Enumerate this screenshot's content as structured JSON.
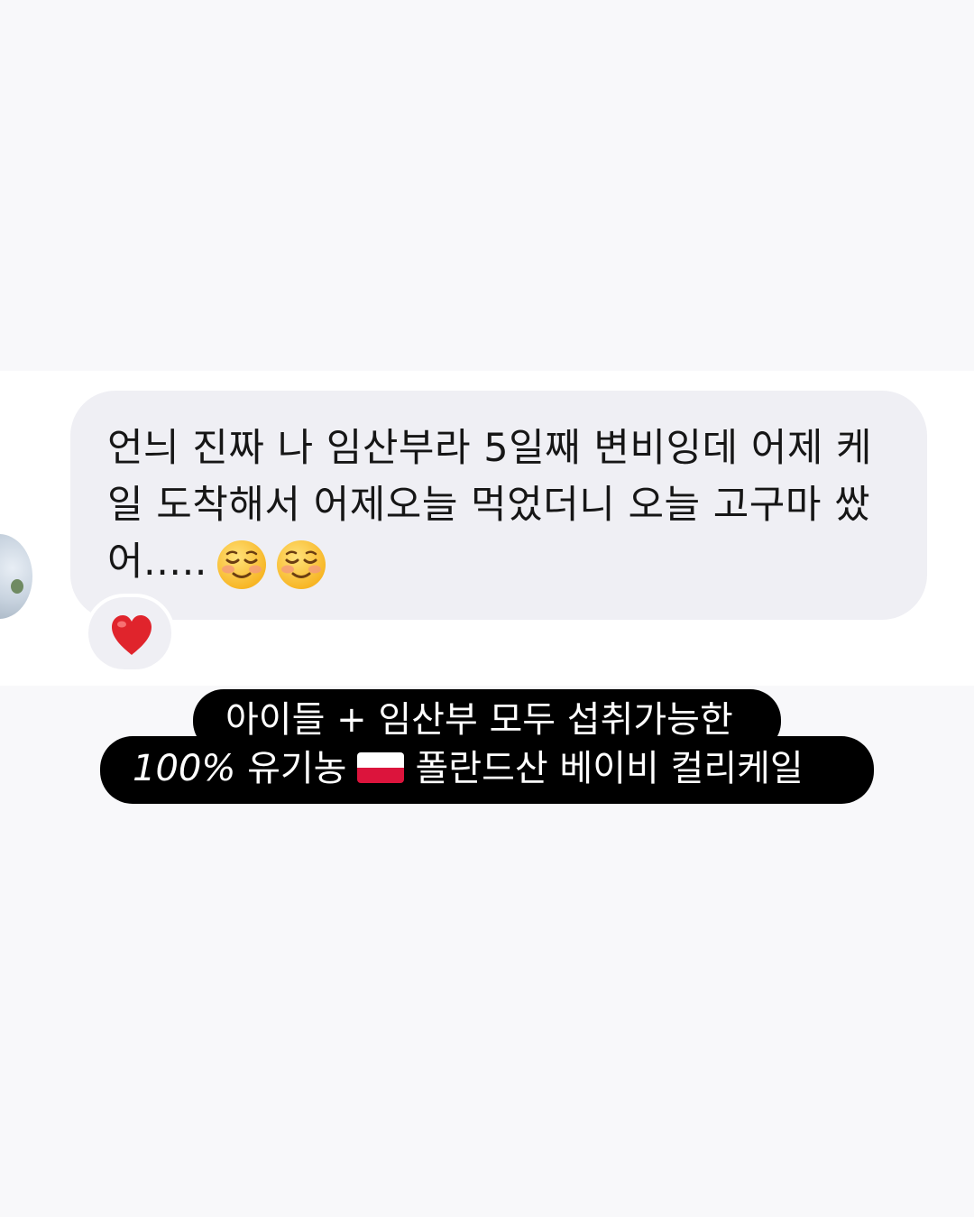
{
  "message": {
    "text": "언늬 진짜 나 임산부라 5일째 변비잉데 어제 케일 도착해서 어제오늘 먹었더니 오늘 고구마 쌌어.....",
    "emojis": [
      "smiling-face-icon",
      "smiling-face-icon"
    ],
    "reaction": "red-heart-icon"
  },
  "caption": {
    "line1": "아이들 + 임산부 모두 섭취가능한",
    "line2_number": "100%",
    "line2_text_a": "유기농",
    "line2_flag": "poland-flag-icon",
    "line2_text_b": "폴란드산 베이비 컬리케일"
  },
  "colors": {
    "page_background": "#f8f8fa",
    "chat_background": "#ffffff",
    "bubble": "#efeff4",
    "caption_background": "#000000",
    "caption_text": "#ffffff",
    "heart": "#e0242c"
  }
}
